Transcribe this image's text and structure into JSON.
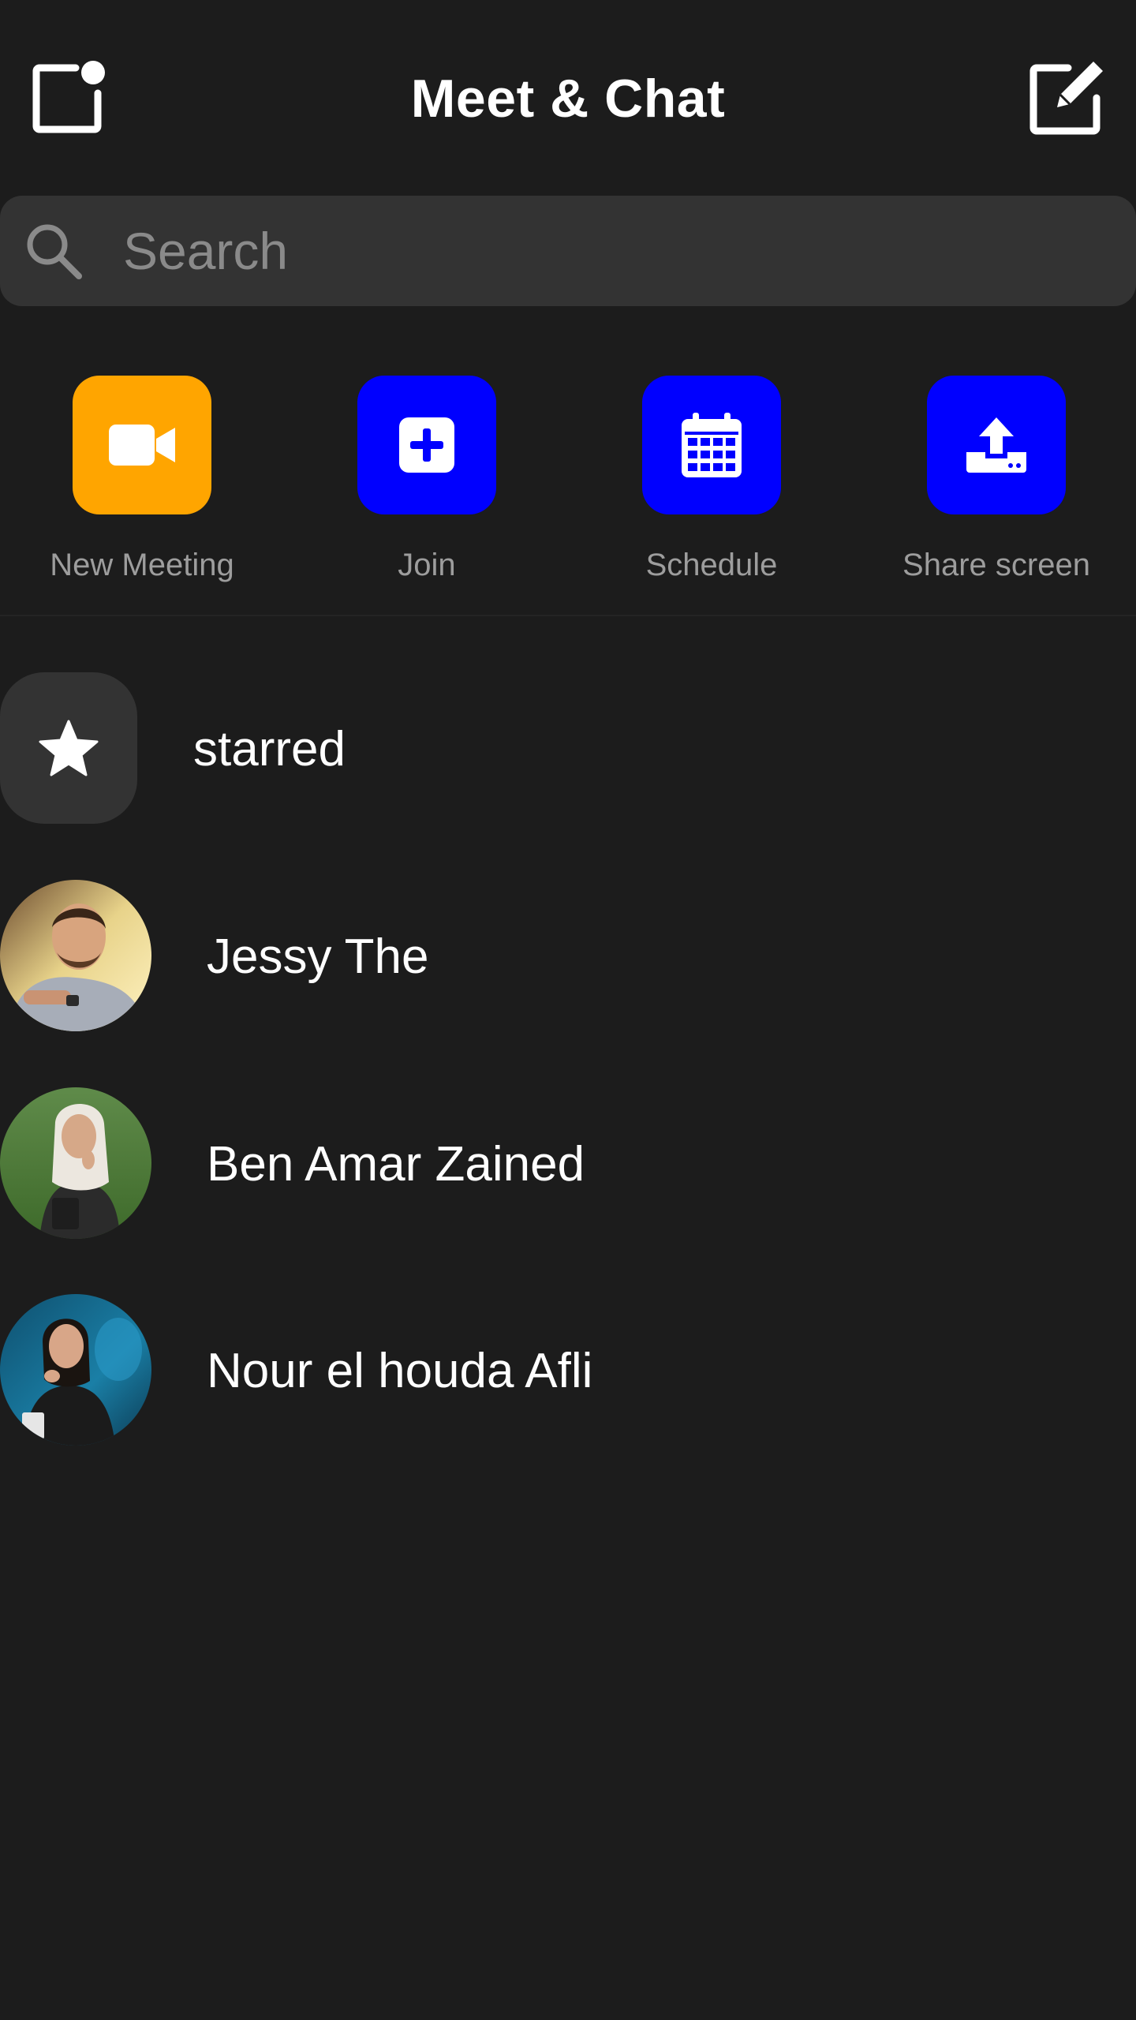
{
  "header": {
    "title": "Meet & Chat",
    "left_icon": "notification-square-icon",
    "right_icon": "compose-icon"
  },
  "search": {
    "placeholder": "Search",
    "icon": "search-icon"
  },
  "actions": [
    {
      "label": "New Meeting",
      "icon": "video-camera-icon",
      "color": "#ffa500"
    },
    {
      "label": "Join",
      "icon": "plus-square-icon",
      "color": "#0000ff"
    },
    {
      "label": "Schedule",
      "icon": "calendar-icon",
      "color": "#0000ff"
    },
    {
      "label": "Share screen",
      "icon": "upload-icon",
      "color": "#0000ff"
    }
  ],
  "starred": {
    "label": "starred",
    "icon": "star-icon"
  },
  "contacts": [
    {
      "name": "Jessy The"
    },
    {
      "name": "Ben Amar Zained"
    },
    {
      "name": "Nour el houda Afli"
    }
  ],
  "colors": {
    "background": "#1c1c1c",
    "surface": "#333333",
    "accent_orange": "#ffa500",
    "accent_blue": "#0000ff",
    "muted_text": "#9d9d9d"
  }
}
